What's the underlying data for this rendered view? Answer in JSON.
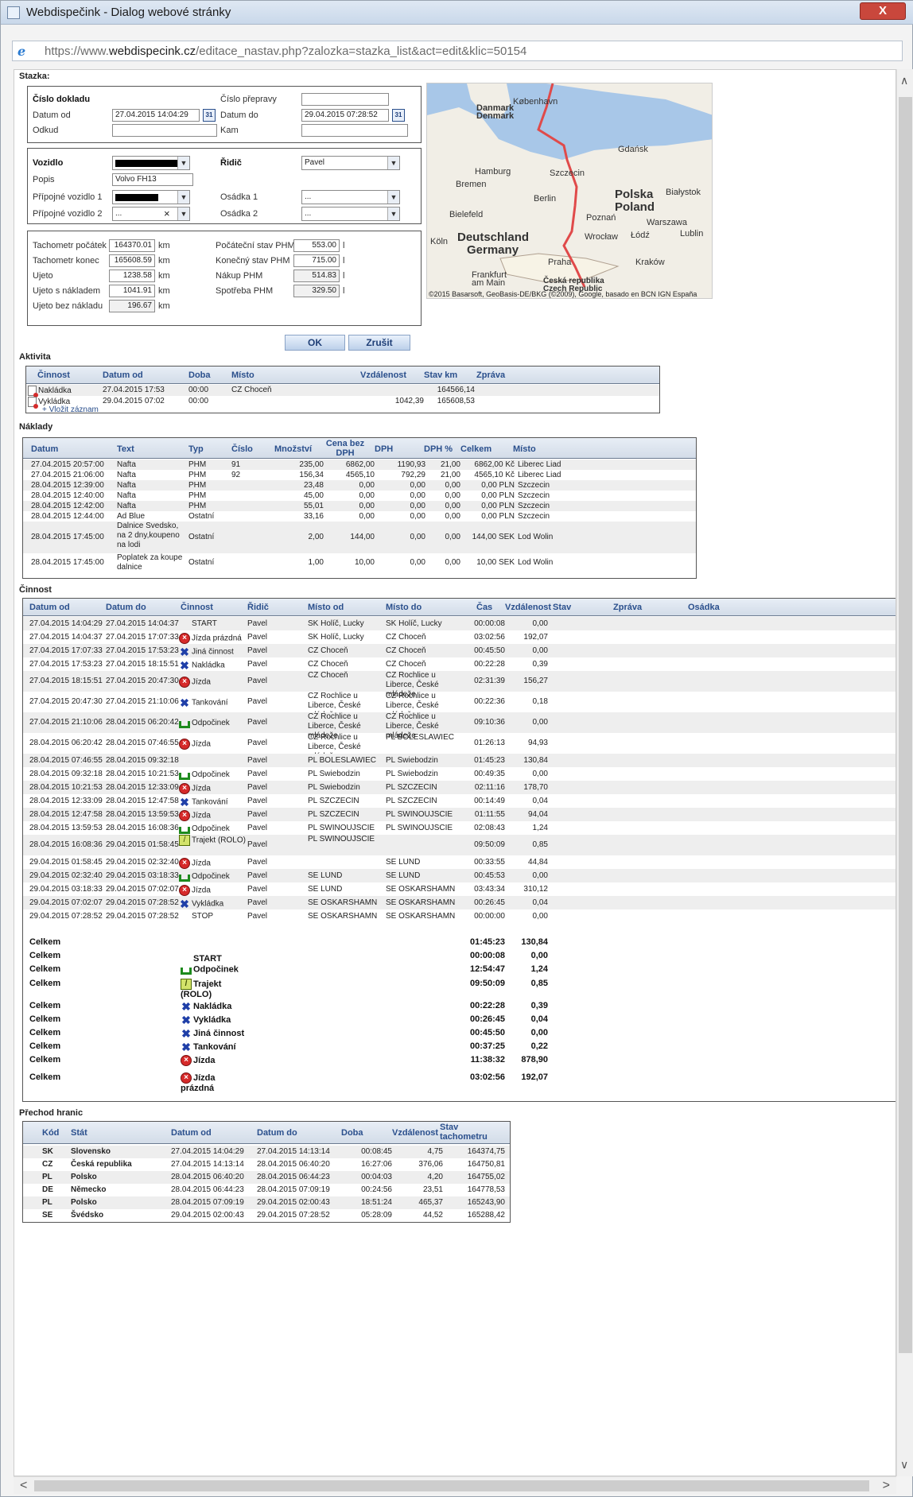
{
  "window": {
    "title": "Webdispečink - Dialog webové stránky",
    "close": "X"
  },
  "address": {
    "prefix": "https://www.",
    "domain": "webdispecink.cz",
    "path": "/editace_nastav.php?zalozka=stazka_list&act=edit&klic=50154"
  },
  "stazka": {
    "heading": "Stazka:",
    "cislo_dokladu": "Číslo dokladu",
    "cislo_prepravy": "Číslo přepravy",
    "datum_od_label": "Datum od",
    "datum_od": "27.04.2015 14:04:29",
    "datum_do_label": "Datum do",
    "datum_do": "29.04.2015 07:28:52",
    "odkud": "Odkud",
    "kam": "Kam",
    "cal": "31",
    "vozidlo": "Vozidlo",
    "ridic_label": "Řidič",
    "ridic": "Pavel",
    "popis_label": "Popis",
    "popis": "Volvo FH13",
    "pripojne1": "Přípojné vozidlo 1",
    "pripojne2": "Přípojné vozidlo 2",
    "pripojne2_value": "...",
    "osadka1": "Osádka 1",
    "osadka1_value": "...",
    "osadka2": "Osádka 2",
    "osadka2_value": "...",
    "clear": "×",
    "tach_pocatek_label": "Tachometr počátek",
    "tach_pocatek": "164370.01",
    "tach_konec_label": "Tachometr konec",
    "tach_konec": "165608.59",
    "ujeto_label": "Ujeto",
    "ujeto": "1238.58",
    "ujeto_s_label": "Ujeto s nákladem",
    "ujeto_s": "1041.91",
    "ujeto_bez_label": "Ujeto bez nákladu",
    "ujeto_bez": "196.67",
    "km": "km",
    "l": "l",
    "pocatecni_label": "Počáteční stav PHM",
    "pocatecni": "553.00",
    "konecny_label": "Konečný stav PHM",
    "konecny": "715.00",
    "nakup_label": "Nákup PHM",
    "nakup": "514.83",
    "spotreba_label": "Spotřeba PHM",
    "spotreba": "329.50",
    "ok": "OK",
    "zrusit": "Zrušit"
  },
  "map": {
    "labels": [
      "Danmark",
      "Denmark",
      "København",
      "Gdańsk",
      "Hamburg",
      "Szczecin",
      "Bremen",
      "Berlin",
      "Polska",
      "Poland",
      "Białystok",
      "Bielefeld",
      "Poznań",
      "Warszawa",
      "Köln",
      "Deutschland",
      "Germany",
      "Wrocław",
      "Łódź",
      "Lublin",
      "Praha",
      "Kraków",
      "Frankfurt",
      "am Main",
      "Česká republika",
      "Czech Republic"
    ],
    "copyright": "©2015 Basarsoft, GeoBasis-DE/BKG (©2009), Google, basado en BCN IGN España",
    "route_color": "#e04a4a",
    "sea_color": "#a8c7e8",
    "land_color": "#f1eee6"
  },
  "aktivita": {
    "heading": "Aktivita",
    "columns": [
      "Činnost",
      "Datum od",
      "Doba",
      "Místo",
      "Vzdálenost",
      "Stav km",
      "Zpráva"
    ],
    "rows": [
      [
        "Nakládka",
        "27.04.2015 17:53",
        "00:00",
        "CZ Choceň",
        "",
        "164566,14",
        ""
      ],
      [
        "Vykládka",
        "29.04.2015 07:02",
        "00:00",
        "",
        "1042,39",
        "165608,53",
        ""
      ]
    ],
    "add": "+ Vložit záznam"
  },
  "naklady": {
    "heading": "Náklady",
    "columns": [
      "Datum",
      "Text",
      "Typ",
      "Číslo",
      "Množství",
      "Cena bez DPH",
      "DPH",
      "DPH %",
      "Celkem",
      "Místo"
    ],
    "rows": [
      [
        "27.04.2015 20:57:00",
        "Nafta",
        "PHM",
        "91",
        "235,00",
        "6862,00",
        "1190,93",
        "21,00",
        "6862,00 Kč",
        "Liberec Liad"
      ],
      [
        "27.04.2015 21:06:00",
        "Nafta",
        "PHM",
        "92",
        "156,34",
        "4565,10",
        "792,29",
        "21,00",
        "4565,10 Kč",
        "Liberec Liad"
      ],
      [
        "28.04.2015 12:39:00",
        "Nafta",
        "PHM",
        "",
        "23,48",
        "0,00",
        "0,00",
        "0,00",
        "0,00 PLN",
        "Szczecin"
      ],
      [
        "28.04.2015 12:40:00",
        "Nafta",
        "PHM",
        "",
        "45,00",
        "0,00",
        "0,00",
        "0,00",
        "0,00 PLN",
        "Szczecin"
      ],
      [
        "28.04.2015 12:42:00",
        "Nafta",
        "PHM",
        "",
        "55,01",
        "0,00",
        "0,00",
        "0,00",
        "0,00 PLN",
        "Szczecin"
      ],
      [
        "28.04.2015 12:44:00",
        "Ad Blue",
        "Ostatní",
        "",
        "33,16",
        "0,00",
        "0,00",
        "0,00",
        "0,00 PLN",
        "Szczecin"
      ],
      [
        "28.04.2015 17:45:00",
        "Dalnice Svedsko, na 2 dny,koupeno na lodi",
        "Ostatní",
        "",
        "2,00",
        "144,00",
        "0,00",
        "0,00",
        "144,00 SEK",
        "Lod Wolin"
      ],
      [
        "28.04.2015 17:45:00",
        "Poplatek za koupe dalnice",
        "Ostatní",
        "",
        "1,00",
        "10,00",
        "0,00",
        "0,00",
        "10,00 SEK",
        "Lod Wolin"
      ]
    ]
  },
  "cinnost": {
    "heading": "Činnost",
    "columns": [
      "Datum od",
      "Datum do",
      "Činnost",
      "Řidič",
      "Místo od",
      "Místo do",
      "Čas",
      "Vzdálenost",
      "Stav",
      "Zpráva",
      "Osádka"
    ],
    "rows": [
      {
        "od": "27.04.2015 14:04:29",
        "do": "27.04.2015 14:04:37",
        "icon": "none",
        "cin": "START",
        "rid": "Pavel",
        "mod": "SK Holíč, Lucky",
        "mdo": "SK Holíč, Lucky",
        "cas": "00:00:08",
        "vzd": "0,00"
      },
      {
        "od": "27.04.2015 14:04:37",
        "do": "27.04.2015 17:07:33",
        "icon": "jizda",
        "cin": "Jízda prázdná",
        "rid": "Pavel",
        "mod": "SK Holíč, Lucky",
        "mdo": "CZ Choceň",
        "cas": "03:02:56",
        "vzd": "192,07"
      },
      {
        "od": "27.04.2015 17:07:33",
        "do": "27.04.2015 17:53:23",
        "icon": "tool",
        "cin": "Jiná činnost",
        "rid": "Pavel",
        "mod": "CZ Choceň",
        "mdo": "CZ Choceň",
        "cas": "00:45:50",
        "vzd": "0,00"
      },
      {
        "od": "27.04.2015 17:53:23",
        "do": "27.04.2015 18:15:51",
        "icon": "tool",
        "cin": "Nakládka",
        "rid": "Pavel",
        "mod": "CZ Choceň",
        "mdo": "CZ Choceň",
        "cas": "00:22:28",
        "vzd": "0,39"
      },
      {
        "od": "27.04.2015 18:15:51",
        "do": "27.04.2015 20:47:30",
        "icon": "jizda",
        "cin": "Jízda",
        "rid": "Pavel",
        "mod": "CZ Choceň",
        "mdo": "CZ Rochlice u Liberce, České mládeže",
        "cas": "02:31:39",
        "vzd": "156,27"
      },
      {
        "od": "27.04.2015 20:47:30",
        "do": "27.04.2015 21:10:06",
        "icon": "tool",
        "cin": "Tankování",
        "rid": "Pavel",
        "mod": "CZ Rochlice u Liberce, České mládeže",
        "mdo": "CZ Rochlice u Liberce, České mládeže",
        "cas": "00:22:36",
        "vzd": "0,18"
      },
      {
        "od": "27.04.2015 21:10:06",
        "do": "28.04.2015 06:20:42",
        "icon": "bed",
        "cin": "Odpočinek",
        "rid": "Pavel",
        "mod": "CZ Rochlice u Liberce, České mládeže",
        "mdo": "CZ Rochlice u Liberce, České mládeže",
        "cas": "09:10:36",
        "vzd": "0,00"
      },
      {
        "od": "28.04.2015 06:20:42",
        "do": "28.04.2015 07:46:55",
        "icon": "jizda",
        "cin": "Jízda",
        "rid": "Pavel",
        "mod": "CZ Rochlice u Liberce, České mládeže",
        "mdo": "PL BOLESLAWIEC",
        "cas": "01:26:13",
        "vzd": "94,93"
      },
      {
        "od": "28.04.2015 07:46:55",
        "do": "28.04.2015 09:32:18",
        "icon": "none",
        "cin": "",
        "rid": "Pavel",
        "mod": "PL BOLESLAWIEC",
        "mdo": "PL Swiebodzin",
        "cas": "01:45:23",
        "vzd": "130,84"
      },
      {
        "od": "28.04.2015 09:32:18",
        "do": "28.04.2015 10:21:53",
        "icon": "bed",
        "cin": "Odpočinek",
        "rid": "Pavel",
        "mod": "PL Swiebodzin",
        "mdo": "PL Swiebodzin",
        "cas": "00:49:35",
        "vzd": "0,00"
      },
      {
        "od": "28.04.2015 10:21:53",
        "do": "28.04.2015 12:33:09",
        "icon": "jizda",
        "cin": "Jízda",
        "rid": "Pavel",
        "mod": "PL Swiebodzin",
        "mdo": "PL SZCZECIN",
        "cas": "02:11:16",
        "vzd": "178,70"
      },
      {
        "od": "28.04.2015 12:33:09",
        "do": "28.04.2015 12:47:58",
        "icon": "tool",
        "cin": "Tankování",
        "rid": "Pavel",
        "mod": "PL SZCZECIN",
        "mdo": "PL SZCZECIN",
        "cas": "00:14:49",
        "vzd": "0,04"
      },
      {
        "od": "28.04.2015 12:47:58",
        "do": "28.04.2015 13:59:53",
        "icon": "jizda",
        "cin": "Jízda",
        "rid": "Pavel",
        "mod": "PL SZCZECIN",
        "mdo": "PL SWINOUJSCIE",
        "cas": "01:11:55",
        "vzd": "94,04"
      },
      {
        "od": "28.04.2015 13:59:53",
        "do": "28.04.2015 16:08:36",
        "icon": "bed",
        "cin": "Odpočinek",
        "rid": "Pavel",
        "mod": "PL SWINOUJSCIE",
        "mdo": "PL SWINOUJSCIE",
        "cas": "02:08:43",
        "vzd": "1,24"
      },
      {
        "od": "28.04.2015 16:08:36",
        "do": "29.04.2015 01:58:45",
        "icon": "traj",
        "cin": "Trajekt (ROLO)",
        "rid": "Pavel",
        "mod": "PL SWINOUJSCIE",
        "mdo": "",
        "cas": "09:50:09",
        "vzd": "0,85"
      },
      {
        "od": "29.04.2015 01:58:45",
        "do": "29.04.2015 02:32:40",
        "icon": "jizda",
        "cin": "Jízda",
        "rid": "Pavel",
        "mod": "",
        "mdo": "SE LUND",
        "cas": "00:33:55",
        "vzd": "44,84"
      },
      {
        "od": "29.04.2015 02:32:40",
        "do": "29.04.2015 03:18:33",
        "icon": "bed",
        "cin": "Odpočinek",
        "rid": "Pavel",
        "mod": "SE LUND",
        "mdo": "SE LUND",
        "cas": "00:45:53",
        "vzd": "0,00"
      },
      {
        "od": "29.04.2015 03:18:33",
        "do": "29.04.2015 07:02:07",
        "icon": "jizda",
        "cin": "Jízda",
        "rid": "Pavel",
        "mod": "SE LUND",
        "mdo": "SE OSKARSHAMN",
        "cas": "03:43:34",
        "vzd": "310,12"
      },
      {
        "od": "29.04.2015 07:02:07",
        "do": "29.04.2015 07:28:52",
        "icon": "tool",
        "cin": "Vykládka",
        "rid": "Pavel",
        "mod": "SE OSKARSHAMN",
        "mdo": "SE OSKARSHAMN",
        "cas": "00:26:45",
        "vzd": "0,04"
      },
      {
        "od": "29.04.2015 07:28:52",
        "do": "29.04.2015 07:28:52",
        "icon": "none",
        "cin": "STOP",
        "rid": "Pavel",
        "mod": "SE OSKARSHAMN",
        "mdo": "SE OSKARSHAMN",
        "cas": "00:00:00",
        "vzd": "0,00"
      }
    ],
    "totals": [
      {
        "lbl": "Celkem",
        "icon": "none",
        "cin": "",
        "cas": "01:45:23",
        "vzd": "130,84"
      },
      {
        "lbl": "Celkem",
        "icon": "none",
        "cin": "START",
        "cas": "00:00:08",
        "vzd": "0,00"
      },
      {
        "lbl": "Celkem",
        "icon": "bed",
        "cin": "Odpočinek",
        "cas": "12:54:47",
        "vzd": "1,24"
      },
      {
        "lbl": "Celkem",
        "icon": "traj",
        "cin": "Trajekt (ROLO)",
        "cas": "09:50:09",
        "vzd": "0,85"
      },
      {
        "lbl": "Celkem",
        "icon": "tool",
        "cin": "Nakládka",
        "cas": "00:22:28",
        "vzd": "0,39"
      },
      {
        "lbl": "Celkem",
        "icon": "tool",
        "cin": "Vykládka",
        "cas": "00:26:45",
        "vzd": "0,04"
      },
      {
        "lbl": "Celkem",
        "icon": "tool",
        "cin": "Jiná činnost",
        "cas": "00:45:50",
        "vzd": "0,00"
      },
      {
        "lbl": "Celkem",
        "icon": "tool",
        "cin": "Tankování",
        "cas": "00:37:25",
        "vzd": "0,22"
      },
      {
        "lbl": "Celkem",
        "icon": "jizda",
        "cin": "Jízda",
        "cas": "11:38:32",
        "vzd": "878,90"
      },
      {
        "lbl": "Celkem",
        "icon": "jizda",
        "cin": "Jízda prázdná",
        "cas": "03:02:56",
        "vzd": "192,07"
      }
    ]
  },
  "hranice": {
    "heading": "Přechod hranic",
    "columns": [
      "Kód",
      "Stát",
      "Datum od",
      "Datum do",
      "Doba",
      "Vzdálenost",
      "Stav tachometru"
    ],
    "rows": [
      [
        "SK",
        "Slovensko",
        "27.04.2015 14:04:29",
        "27.04.2015 14:13:14",
        "00:08:45",
        "4,75",
        "164374,75"
      ],
      [
        "CZ",
        "Česká republika",
        "27.04.2015 14:13:14",
        "28.04.2015 06:40:20",
        "16:27:06",
        "376,06",
        "164750,81"
      ],
      [
        "PL",
        "Polsko",
        "28.04.2015 06:40:20",
        "28.04.2015 06:44:23",
        "00:04:03",
        "4,20",
        "164755,02"
      ],
      [
        "DE",
        "Německo",
        "28.04.2015 06:44:23",
        "28.04.2015 07:09:19",
        "00:24:56",
        "23,51",
        "164778,53"
      ],
      [
        "PL",
        "Polsko",
        "28.04.2015 07:09:19",
        "29.04.2015 02:00:43",
        "18:51:24",
        "465,37",
        "165243,90"
      ],
      [
        "SE",
        "Švédsko",
        "29.04.2015 02:00:43",
        "29.04.2015 07:28:52",
        "05:28:09",
        "44,52",
        "165288,42"
      ]
    ]
  }
}
